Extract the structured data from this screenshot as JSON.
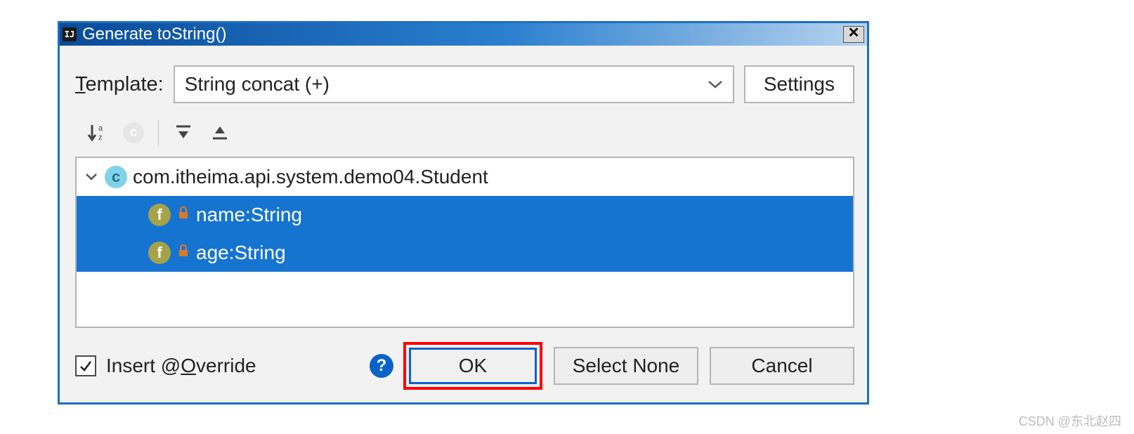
{
  "title": "Generate toString()",
  "template": {
    "label_pre": "T",
    "label_post": "emplate:",
    "selected": "String concat (+)",
    "settings": "Settings"
  },
  "icons": {
    "ij": "IJ",
    "close": "✕",
    "sort": "↓",
    "sort_sub": "a\nz",
    "class_badge": "c",
    "field_badge": "f",
    "lock": "🔒",
    "help": "?"
  },
  "tree": {
    "class_name": "com.itheima.api.system.demo04.Student",
    "fields": [
      {
        "label": "name:String"
      },
      {
        "label": "age:String"
      }
    ]
  },
  "override": {
    "pre": "Insert @",
    "ul": "O",
    "post": "verride"
  },
  "buttons": {
    "ok": "OK",
    "select_none": "Select None",
    "cancel": "Cancel"
  },
  "watermark": "CSDN @东北赵四"
}
